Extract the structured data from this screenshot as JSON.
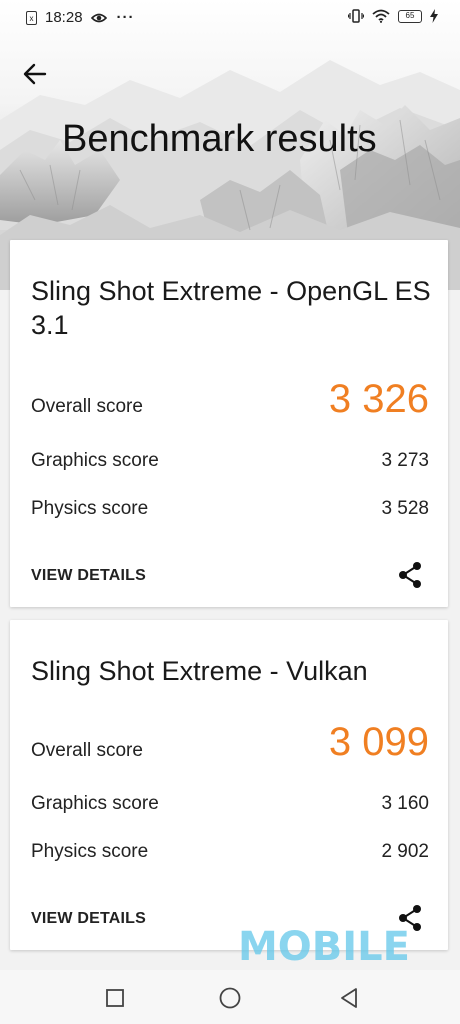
{
  "status_bar": {
    "time": "18:28",
    "sim_label": "x",
    "more_indicator": "···",
    "battery_level": "65",
    "icons": [
      "sim-card-icon",
      "eye-icon",
      "vibrate-icon",
      "wifi-icon",
      "battery-icon",
      "charging-bolt-icon"
    ]
  },
  "header": {
    "title": "Benchmark results",
    "back_icon": "back-arrow-icon"
  },
  "cards": [
    {
      "title": "Sling Shot Extreme - OpenGL ES 3.1",
      "overall_label": "Overall score",
      "overall_value": "3 326",
      "graphics_label": "Graphics score",
      "graphics_value": "3 273",
      "physics_label": "Physics score",
      "physics_value": "3 528",
      "details_label": "VIEW DETAILS",
      "share_icon": "share-icon"
    },
    {
      "title": "Sling Shot Extreme - Vulkan",
      "overall_label": "Overall score",
      "overall_value": "3 099",
      "graphics_label": "Graphics score",
      "graphics_value": "3 160",
      "physics_label": "Physics score",
      "physics_value": "2 902",
      "details_label": "VIEW DETAILS",
      "share_icon": "share-icon"
    }
  ],
  "watermark": "MOBILE",
  "nav_bar": {
    "icons": [
      "recent-apps-icon",
      "home-icon",
      "back-triangle-icon"
    ]
  },
  "colors": {
    "accent": "#f07f22",
    "watermark": "#64c8ea",
    "card_bg": "#ffffff",
    "page_bg": "#f2f2f2"
  }
}
